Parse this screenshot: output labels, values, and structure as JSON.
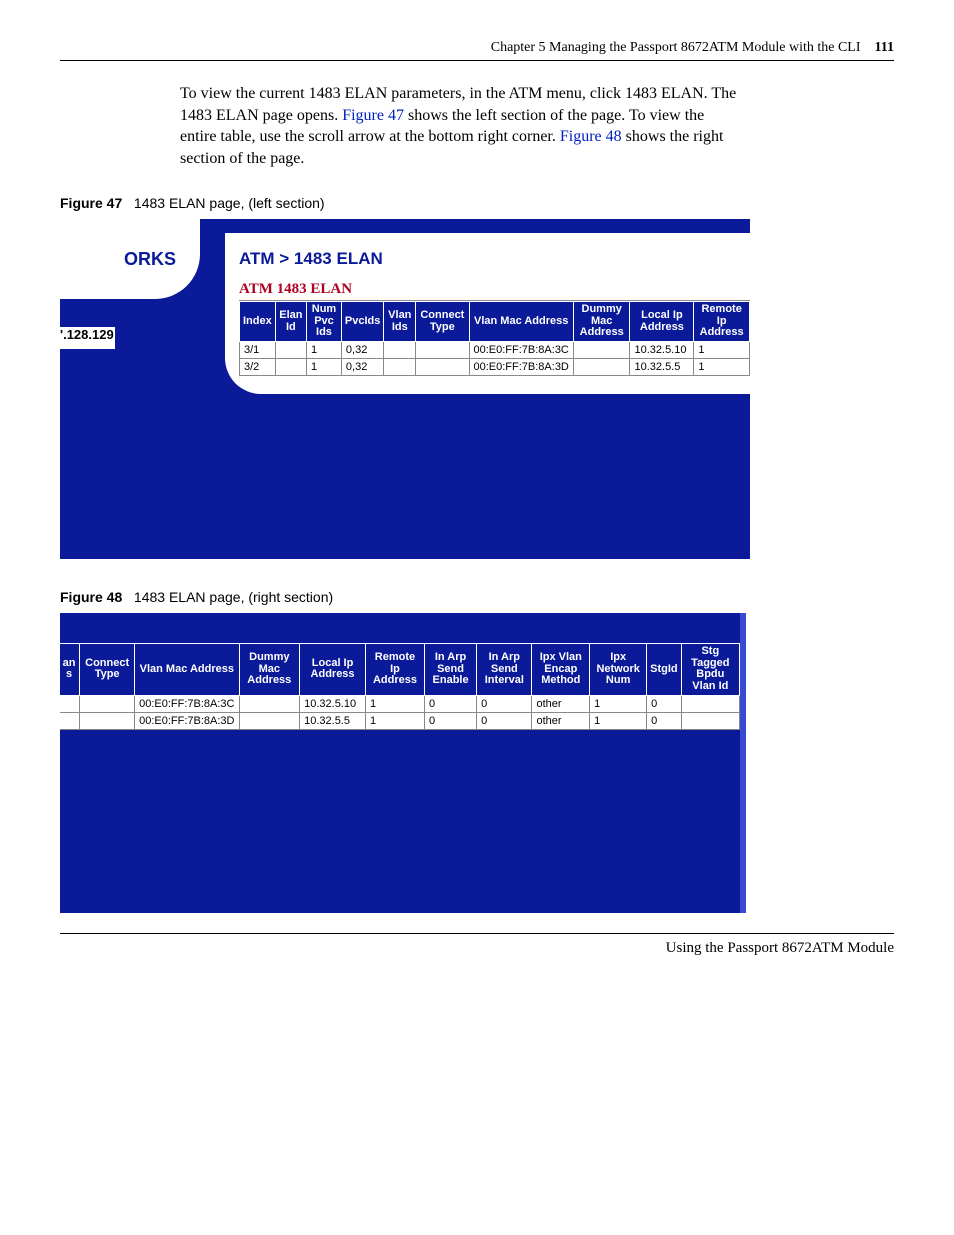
{
  "header": {
    "chapter_label": "Chapter 5   Managing the Passport 8672ATM Module with the CLI",
    "page_number": "111"
  },
  "paragraph": {
    "line1a": "To view the current 1483 ELAN parameters, in the ATM menu, click 1483 ELAN. The 1483 ELAN page opens. ",
    "xref47": "Figure 47",
    "line1b": " shows the left section of the page. To view the entire table, use the scroll arrow at the bottom right corner. ",
    "xref48": "Figure 48",
    "line1c": " shows the right section of the page."
  },
  "figure47": {
    "label_bold": "Figure 47",
    "label_rest": "1483 ELAN page, (left section)",
    "logo_fragment": "ORKS",
    "ip_fragment": "'.128.129",
    "breadcrumb": "ATM > 1483 ELAN",
    "section_title": "ATM 1483 ELAN",
    "headers": [
      "Index",
      "Elan Id",
      "Num Pvc Ids",
      "PvcIds",
      "Vlan Ids",
      "Connect Type",
      "Vlan Mac Address",
      "Dummy Mac Address",
      "Local Ip Address",
      "Remote Ip Address"
    ],
    "rows": [
      {
        "index": "3/1",
        "elan": "",
        "numpvc": "1",
        "pvcids": "0,32",
        "vlanids": "",
        "connect": "",
        "mac": "00:E0:FF:7B:8A:3C",
        "dummy": "",
        "localip": "10.32.5.10",
        "remoteip": "1"
      },
      {
        "index": "3/2",
        "elan": "",
        "numpvc": "1",
        "pvcids": "0,32",
        "vlanids": "",
        "connect": "",
        "mac": "00:E0:FF:7B:8A:3D",
        "dummy": "",
        "localip": "10.32.5.5",
        "remoteip": "1"
      }
    ]
  },
  "figure48": {
    "label_bold": "Figure 48",
    "label_rest": "1483 ELAN page, (right section)",
    "headers": [
      "an s",
      "Connect Type",
      "Vlan Mac Address",
      "Dummy Mac Address",
      "Local Ip Address",
      "Remote Ip Address",
      "In Arp Send Enable",
      "In Arp Send Interval",
      "Ipx Vlan Encap Method",
      "Ipx Network Num",
      "StgId",
      "Stg Tagged Bpdu Vlan Id"
    ],
    "rows": [
      {
        "ans": "",
        "connect": "",
        "mac": "00:E0:FF:7B:8A:3C",
        "dummy": "",
        "localip": "10.32.5.10",
        "remote": "1",
        "arpen": "0",
        "arpint": "0",
        "ipxm": "other",
        "ipxn": "1",
        "stgid": "0",
        "stgv": ""
      },
      {
        "ans": "",
        "connect": "",
        "mac": "00:E0:FF:7B:8A:3D",
        "dummy": "",
        "localip": "10.32.5.5",
        "remote": "1",
        "arpen": "0",
        "arpint": "0",
        "ipxm": "other",
        "ipxn": "1",
        "stgid": "0",
        "stgv": ""
      }
    ]
  },
  "footer": {
    "text": "Using the Passport 8672ATM Module"
  }
}
